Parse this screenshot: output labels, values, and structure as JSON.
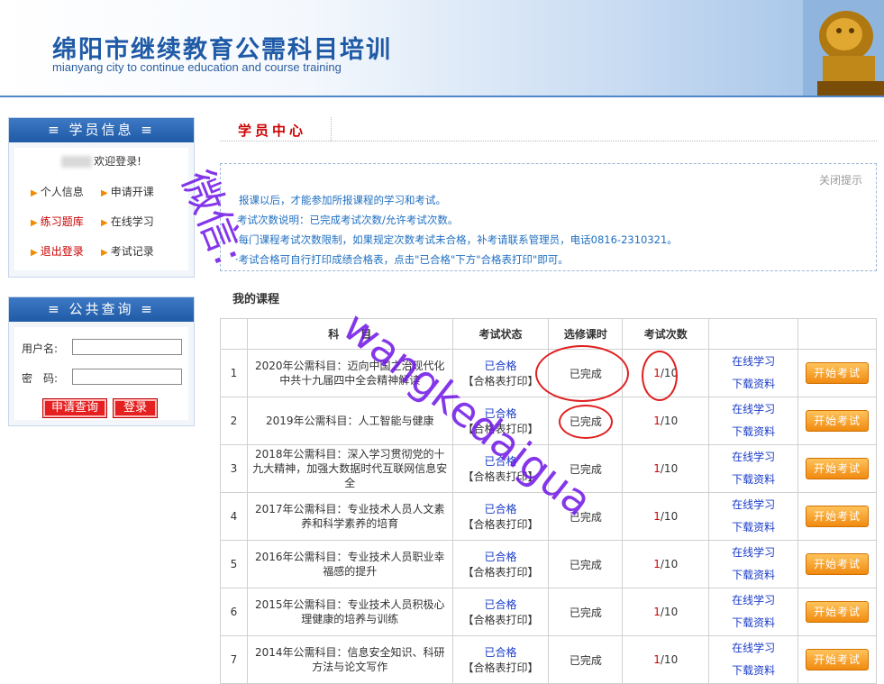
{
  "header": {
    "title": "绵阳市继续教育公需科目培训",
    "subtitle": "mianyang city to continue education and course training"
  },
  "student_panel": {
    "title": "学员信息",
    "welcome": "欢迎登录!",
    "links": [
      "个人信息",
      "申请开课",
      "练习题库",
      "在线学习",
      "退出登录",
      "考试记录"
    ]
  },
  "query_panel": {
    "title": "公共查询",
    "username_label": "用户名:",
    "password_label": "密　码:",
    "query_button": "申请查询",
    "login_button": "登录"
  },
  "main": {
    "tab_title": "学员中心",
    "close_tip": "关闭提示",
    "notices": [
      "报课以后，才能参加所报课程的学习和考试。",
      "考试次数说明：已完成考试次数/允许考试次数。",
      "·每门课程考试次数限制，如果规定次数考试未合格，补考请联系管理员，电话0816-2310321。",
      "·考试合格可自行打印成绩合格表，点击\"已合格\"下方\"合格表打印\"即可。"
    ],
    "my_courses_label": "我的课程"
  },
  "table": {
    "headers": [
      "",
      "科　　目",
      "考试状态",
      "选修课时",
      "考试次数",
      "",
      ""
    ],
    "rows": [
      {
        "no": "1",
        "name": "2020年公需科目：迈向中国之治现代化中共十九届四中全会精神解读",
        "status": "已合格",
        "print": "【合格表打印】",
        "hours": "已完成",
        "count_done": "1",
        "count_total": "/10",
        "study": "在线学习",
        "download": "下载资料",
        "exam": "开始考试"
      },
      {
        "no": "2",
        "name": "2019年公需科目：人工智能与健康",
        "status": "已合格",
        "print": "【合格表打印】",
        "hours": "已完成",
        "count_done": "1",
        "count_total": "/10",
        "study": "在线学习",
        "download": "下载资料",
        "exam": "开始考试"
      },
      {
        "no": "3",
        "name": "2018年公需科目：深入学习贯彻党的十九大精神，加强大数据时代互联网信息安全",
        "status": "已合格",
        "print": "【合格表打印】",
        "hours": "已完成",
        "count_done": "1",
        "count_total": "/10",
        "study": "在线学习",
        "download": "下载资料",
        "exam": "开始考试"
      },
      {
        "no": "4",
        "name": "2017年公需科目：专业技术人员人文素养和科学素养的培育",
        "status": "已合格",
        "print": "【合格表打印】",
        "hours": "已完成",
        "count_done": "1",
        "count_total": "/10",
        "study": "在线学习",
        "download": "下载资料",
        "exam": "开始考试"
      },
      {
        "no": "5",
        "name": "2016年公需科目：专业技术人员职业幸福感的提升",
        "status": "已合格",
        "print": "【合格表打印】",
        "hours": "已完成",
        "count_done": "1",
        "count_total": "/10",
        "study": "在线学习",
        "download": "下载资料",
        "exam": "开始考试"
      },
      {
        "no": "6",
        "name": "2015年公需科目：专业技术人员积极心理健康的培养与训练",
        "status": "已合格",
        "print": "【合格表打印】",
        "hours": "已完成",
        "count_done": "1",
        "count_total": "/10",
        "study": "在线学习",
        "download": "下载资料",
        "exam": "开始考试"
      },
      {
        "no": "7",
        "name": "2014年公需科目：信息安全知识、科研方法与论文写作",
        "status": "已合格",
        "print": "【合格表打印】",
        "hours": "已完成",
        "count_done": "1",
        "count_total": "/10",
        "study": "在线学习",
        "download": "下载资料",
        "exam": "开始考试"
      }
    ]
  },
  "watermark": {
    "line1": "微信:",
    "line2": "wangkedaigua"
  },
  "colors": {
    "brand_blue": "#1f5aa6",
    "accent_red": "#cc0000",
    "link_blue": "#1a3cc8",
    "button_orange": "#f08a10",
    "watermark_purple": "#6e14e6"
  }
}
